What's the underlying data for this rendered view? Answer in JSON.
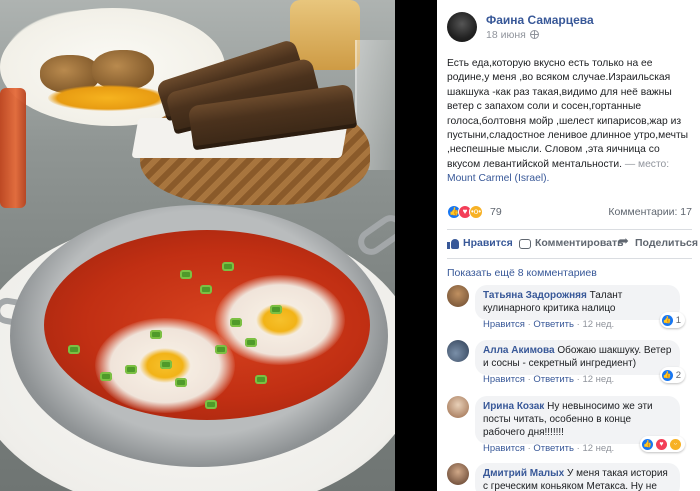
{
  "post": {
    "author": "Фаина Самарцева",
    "date": "18 июня",
    "text": "Есть еда,которую вкусно есть только на ее родине,у меня ,во всяком случае.Израильская шакшука -как раз такая,видимо для неё важны ветер с запахом соли и сосен,гортанные голоса,болтовня мойр ,шелест кипарисов,жар из пустыни,сладостное ленивое длинное утро,мечты ,неспешные мысли. Словом ,эта яичница со вкусом левантийской ментальности.",
    "place_prefix": "— место:",
    "place_link": "Mount Carmel (Israel).",
    "reaction_count": "79",
    "comments_label": "Комментарии: 17"
  },
  "actions": {
    "like": "Нравится",
    "comment": "Комментировать",
    "share": "Поделиться"
  },
  "show_more": "Показать ещё 8 комментариев",
  "comments": [
    {
      "name": "Татьяна Задорожняя",
      "text": "Талант кулинарного критика налицо",
      "like": "Нравится",
      "reply": "Ответить",
      "ago": "12 нед.",
      "reactions": "1"
    },
    {
      "name": "Алла Акимова",
      "text": "Обожаю шакшуку. Ветер и сосны - секретный ингредиент)",
      "like": "Нравится",
      "reply": "Ответить",
      "ago": "12 нед.",
      "reactions": "2"
    },
    {
      "name": "Ирина Козак",
      "text": "Ну невыносимо же эти посты читать, особенно в конце рабочего дня!!!!!!!",
      "like": "Нравится",
      "reply": "Ответить",
      "ago": "12 нед.",
      "reactions": ""
    },
    {
      "name": "Дмитрий Малых",
      "text": "У меня такая история с греческим коньяком Метакса. Ну не",
      "like": "",
      "reply": "",
      "ago": "",
      "reactions": ""
    }
  ],
  "icons": {
    "like_reaction": "thumbs-up",
    "love_reaction": "heart",
    "wow_reaction": "wow-face",
    "privacy": "globe",
    "options": "more-dots"
  },
  "colors": {
    "link": "#385898",
    "like_blue": "#1877f2",
    "muted": "#90949c",
    "bubble": "#f2f3f5"
  }
}
